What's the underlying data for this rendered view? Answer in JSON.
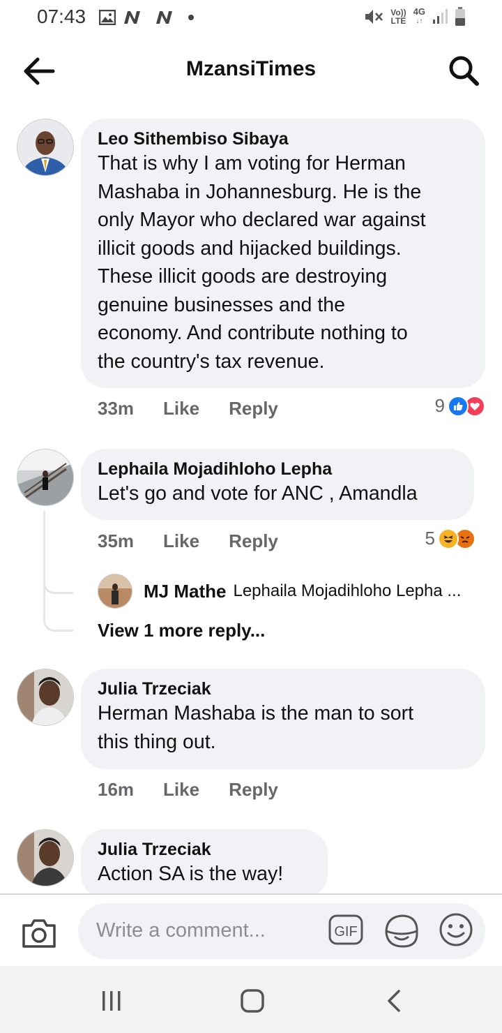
{
  "status_bar": {
    "time": "07:43",
    "network_label_top": "Vo))",
    "network_label_bottom": "LTE",
    "network_type": "4G"
  },
  "header": {
    "title": "MzansiTimes",
    "back_icon": "arrow-left-icon",
    "search_icon": "search-icon"
  },
  "comments": [
    {
      "author": "Leo Sithembiso Sibaya",
      "text": "That is why I am voting for Herman\nMashaba in Johannesburg. He is the\nonly Mayor who declared war against\nillicit goods and hijacked buildings.\nThese illicit goods are destroying\ngenuine businesses and the\neconomy. And contribute nothing to\nthe country's tax revenue.",
      "time": "33m",
      "like_label": "Like",
      "reply_label": "Reply",
      "reaction_count": "9",
      "reactions": [
        "like-reaction-icon",
        "love-reaction-icon"
      ]
    },
    {
      "author": "Lephaila Mojadihloho Lepha",
      "text": "Let's go and vote for ANC , Amandla",
      "time": "35m",
      "like_label": "Like",
      "reply_label": "Reply",
      "reaction_count": "5",
      "reactions": [
        "haha-reaction-icon",
        "angry-reaction-icon"
      ],
      "reply_preview": {
        "author": "MJ Mathe",
        "text": "Lephaila Mojadihloho Lepha ..."
      },
      "view_more": "View 1 more reply..."
    },
    {
      "author": "Julia Trzeciak",
      "text": "Herman Mashaba is the man to sort\nthis thing out.",
      "time": "16m",
      "like_label": "Like",
      "reply_label": "Reply"
    },
    {
      "author": "Julia Trzeciak",
      "text": "Action SA is the way!"
    }
  ],
  "composer": {
    "placeholder": "Write a comment...",
    "gif_label": "GIF"
  },
  "colors": {
    "bubble": "#f0f2f5",
    "meta_text": "#65676b",
    "like_blue": "#1877f2",
    "love_red": "#f33e58",
    "haha_yellow": "#f7b125",
    "angry_orange": "#e9710f"
  }
}
